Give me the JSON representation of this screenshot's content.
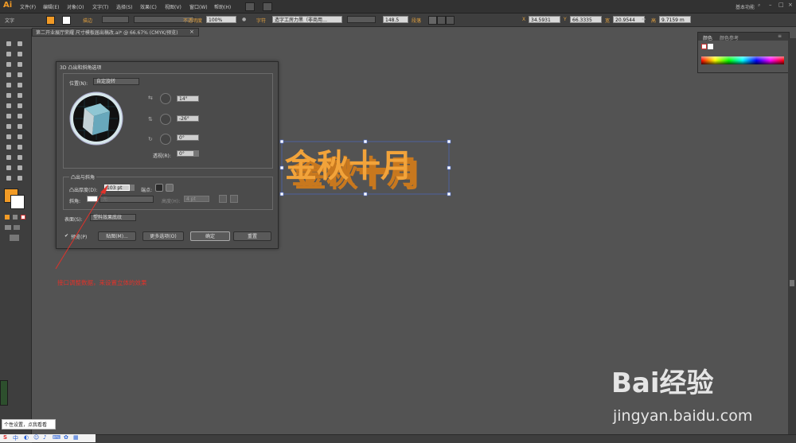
{
  "app": {
    "logo": "Ai"
  },
  "menu": [
    "文件(F)",
    "编辑(E)",
    "对象(O)",
    "文字(T)",
    "选择(S)",
    "效果(C)",
    "视图(V)",
    "窗口(W)",
    "帮助(H)"
  ],
  "workspace": {
    "label": "基本功能",
    "search_icon": "search-icon"
  },
  "controlbar": {
    "tool_label": "文字",
    "stroke_label": "描边",
    "opacity_label": "不透明度",
    "opacity_value": "100%",
    "char_label": "字符",
    "font_name": "造字工房力黑（非商用…",
    "font_size": "148.5",
    "para_label": "段落",
    "x_label": "X",
    "x_value": "34.5931",
    "y_label": "Y",
    "y_value": "66.3335",
    "w_label": "宽",
    "w_value": "20.9544",
    "h_label": "高",
    "h_value": "9.7159 m"
  },
  "document_tab": {
    "title": "第二开业展厅荣耀 尺寸模板届出稿改.ai* @ 66.67% (CMYK/预览)",
    "close": "×"
  },
  "color_panel": {
    "tab_color": "颜色",
    "tab_guide": "颜色参考"
  },
  "dialog": {
    "title": "3D 凸出和斜角选项",
    "position_label": "位置(N):",
    "position_value": "自定旋转",
    "rot_x": "14°",
    "rot_y": "-26°",
    "rot_z": "0°",
    "perspective_label": "透视(R):",
    "perspective_value": "0°",
    "section_extrude": "凸出与斜角",
    "depth_label": "凸出厚度(D):",
    "depth_value": "103 pt",
    "cap_label": "端点:",
    "bevel_label": "斜角:",
    "bevel_value": "无",
    "height_label": "高度(H):",
    "height_value": "4 pt",
    "surface_label": "表面(S):",
    "surface_value": "塑料效果底纹",
    "preview_label": "预览(P)",
    "map_button": "贴图(M)...",
    "more_button": "更多选项(O)",
    "ok_button": "确定",
    "cancel_button": "重置"
  },
  "artwork": {
    "text": "金秋十月",
    "front_color": "#f2a33a",
    "side_color": "#c8781e"
  },
  "annotation": {
    "text": "接口调整数据，来设置立体的效果",
    "color": "#e0322a"
  },
  "tooltip": {
    "text": "个性设置，点我看看"
  },
  "watermark": {
    "brand": "Bai经验",
    "url": "jingyan.baidu.com"
  }
}
